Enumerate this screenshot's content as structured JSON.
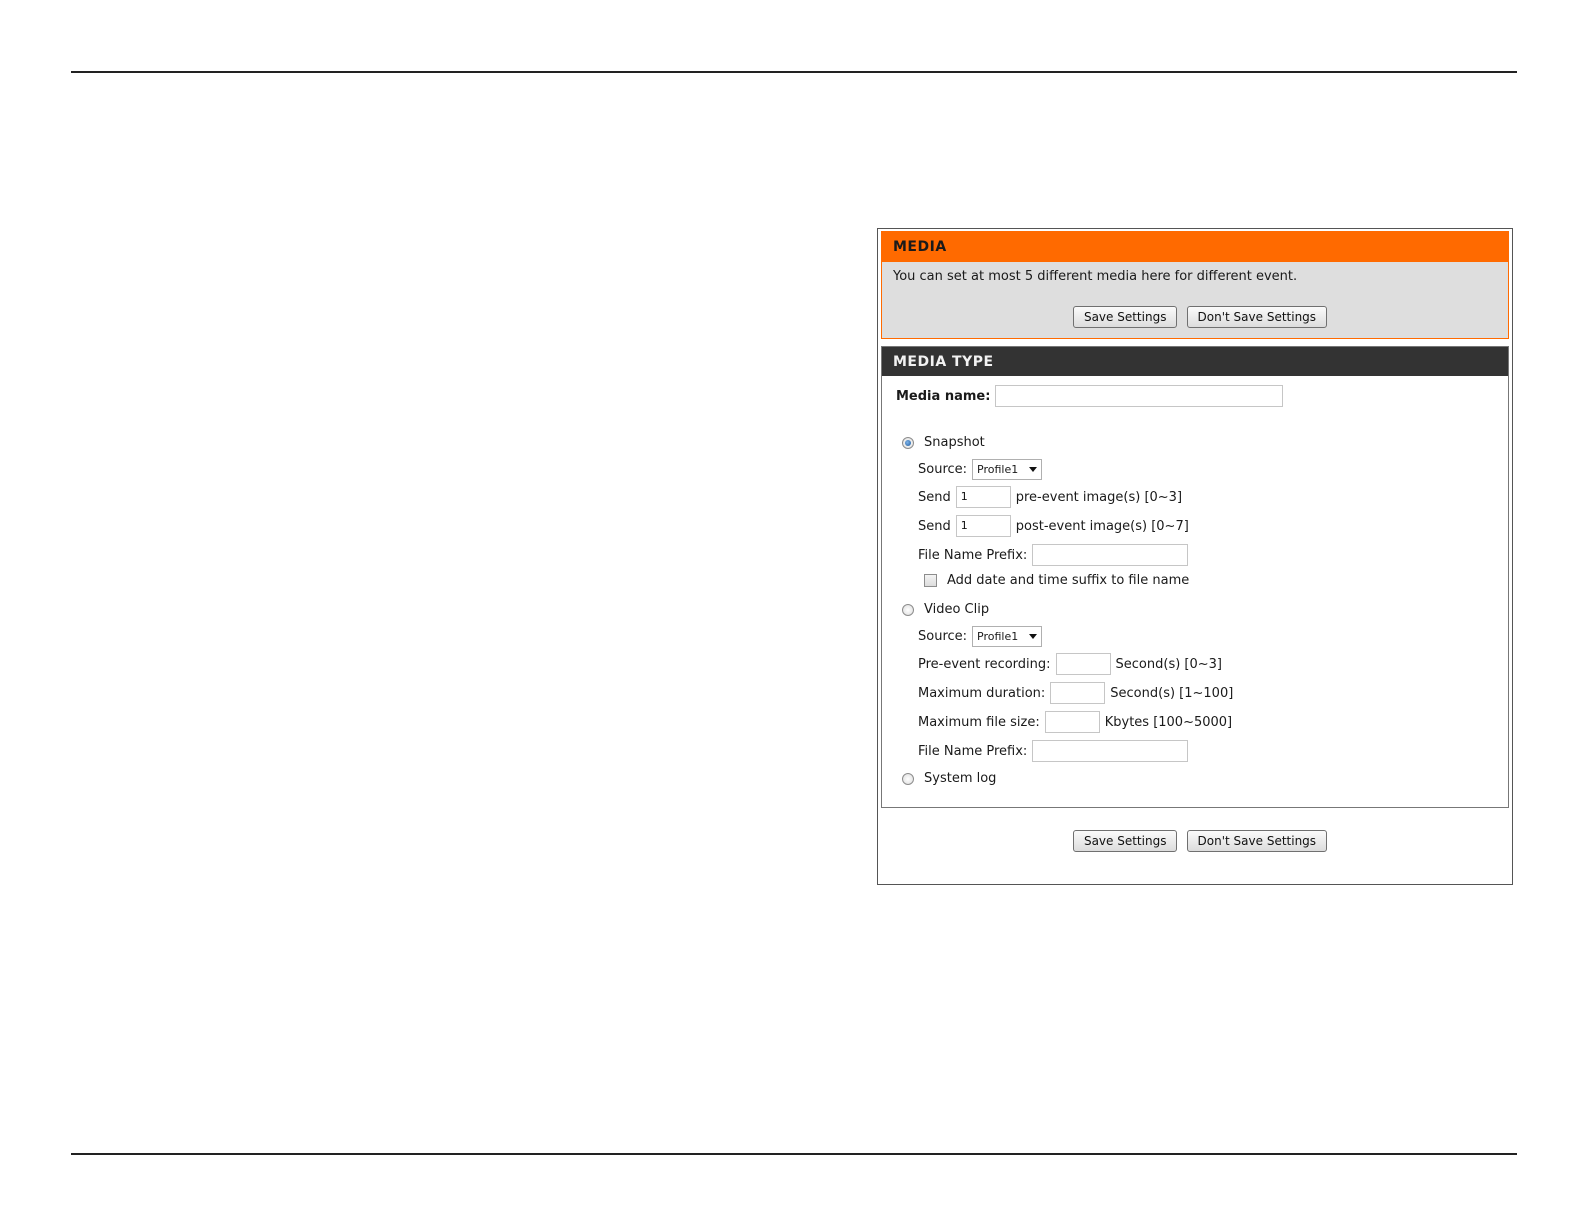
{
  "media": {
    "title": "MEDIA",
    "description": "You can set at most 5 different media here for different event.",
    "save_label": "Save Settings",
    "dont_save_label": "Don't Save Settings"
  },
  "media_type": {
    "title": "MEDIA TYPE",
    "media_name_label": "Media name:",
    "media_name_value": "",
    "snapshot": {
      "label": "Snapshot",
      "selected": true,
      "source_label": "Source:",
      "source_value": "Profile1",
      "send_label": "Send",
      "pre_event_value": "1",
      "pre_event_label": "pre-event image(s) [0~3]",
      "post_event_value": "1",
      "post_event_label": "post-event image(s) [0~7]",
      "prefix_label": "File Name Prefix:",
      "prefix_value": "",
      "suffix_label": "Add date and time suffix to file name",
      "suffix_checked": false
    },
    "video_clip": {
      "label": "Video Clip",
      "selected": false,
      "source_label": "Source:",
      "source_value": "Profile1",
      "pre_event_label": "Pre-event recording:",
      "pre_event_value": "",
      "pre_event_unit": "Second(s) [0~3]",
      "max_duration_label": "Maximum duration:",
      "max_duration_value": "",
      "max_duration_unit": "Second(s) [1~100]",
      "max_size_label": "Maximum file size:",
      "max_size_value": "",
      "max_size_unit": "Kbytes [100~5000]",
      "prefix_label": "File Name Prefix:",
      "prefix_value": ""
    },
    "system_log": {
      "label": "System log",
      "selected": false
    }
  },
  "footer": {
    "save_label": "Save Settings",
    "dont_save_label": "Don't Save Settings"
  }
}
